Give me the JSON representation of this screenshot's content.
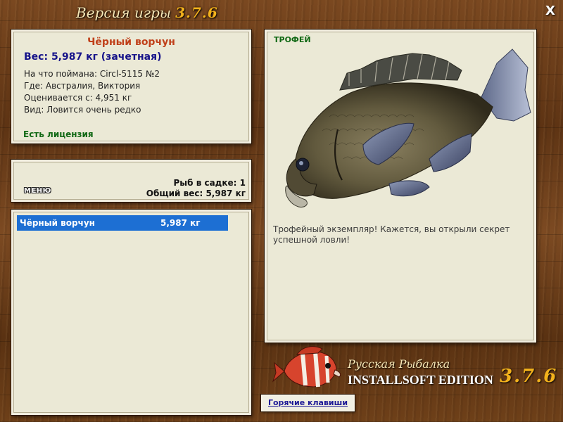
{
  "header": {
    "version_label": "Версия игры",
    "version_number": "3.7.6",
    "close_label": "X"
  },
  "fish_info": {
    "name": "Чёрный ворчун",
    "weight": "Вес: 5,987 кг (зачетная)",
    "bait": "На что поймана: Circl-5115 №2",
    "location": "Где: Австралия, Виктория",
    "value": "Оценивается с: 4,951 кг",
    "rarity": "Вид: Ловится очень редко",
    "license": "Есть лицензия"
  },
  "summary": {
    "menu_label": "МЕНЮ",
    "fish_in_keepnet": "Рыб в садке: 1",
    "total_weight": "Общий вес: 5,987 кг"
  },
  "catch_list": [
    {
      "name": "Чёрный ворчун",
      "weight": "5,987 кг"
    }
  ],
  "trophy": {
    "label": "ТРОФЕЙ",
    "description": "Трофейный экземпляр! Кажется, вы открыли секрет успешной ловли!"
  },
  "logo": {
    "title": "Русская Рыбалка",
    "edition": "INSTALLSOFT EDITION",
    "version": "3.7.6"
  },
  "footer": {
    "hotkeys_label": "Горячие клавиши"
  },
  "colors": {
    "fish_name": "#c0401a",
    "weight_text": "#17148a",
    "license_text": "#106814",
    "selection": "#1d6fd3",
    "version_gold": "#f3b21c"
  }
}
